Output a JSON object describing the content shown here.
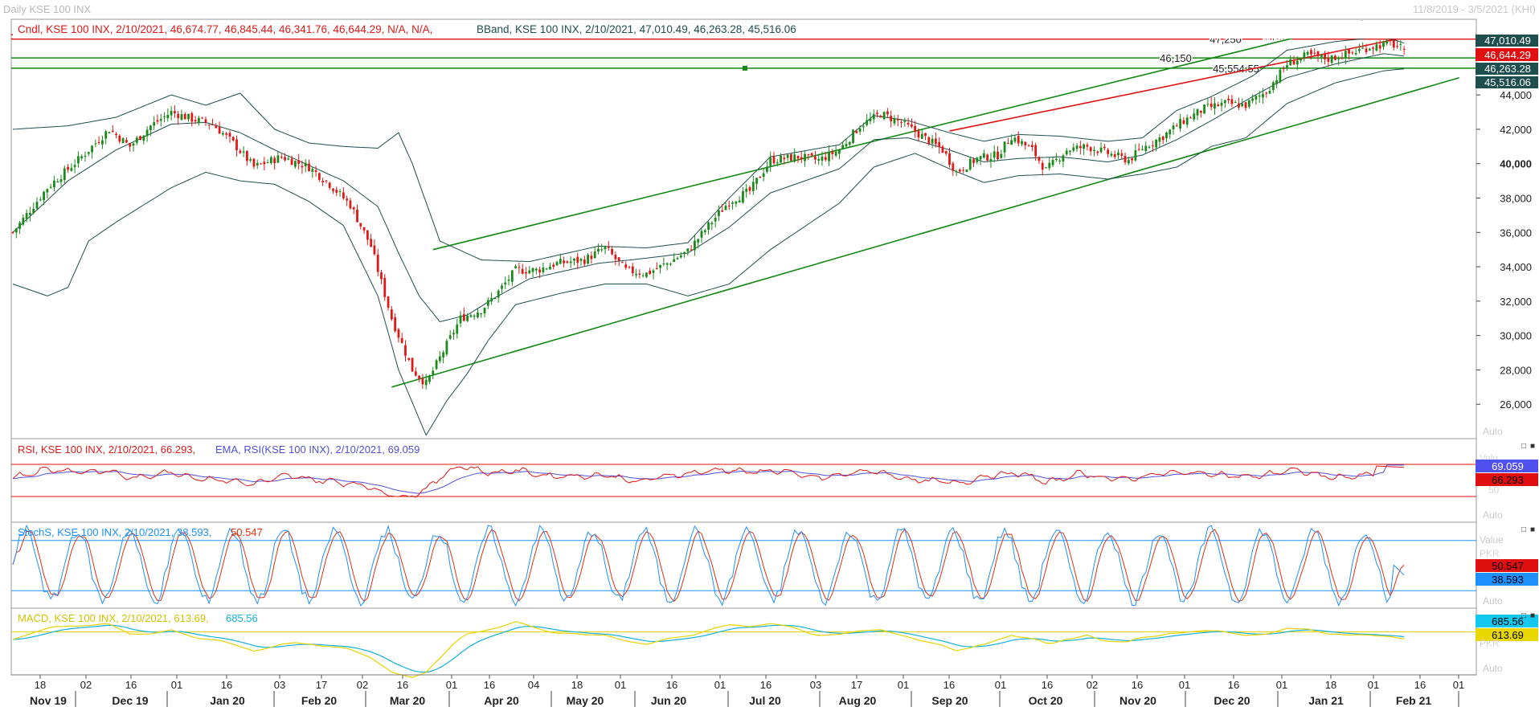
{
  "window": {
    "title": "Daily KSE 100 INX",
    "date_range": "11/8/2019 - 3/5/2021 (KHI)"
  },
  "colors": {
    "up": "#1a8a1a",
    "down": "#e01818",
    "bband": "#1f4e4e",
    "trendline_green": "#118811",
    "trendline_red": "#e01010",
    "rsi": "#e01818",
    "rsi_ema": "#5050dd",
    "stoch_k": "#1e90ff",
    "stoch_d": "#e03010",
    "macd": "#e8d200",
    "macd_signal": "#12b0e0",
    "price_tag_bg": "#1f4e4e"
  },
  "main_panel": {
    "legend_candle": "Cndl, KSE 100 INX, 2/10/2021, 46,674.77, 46,845.44, 46,341.76, 46,644.29, N/A, N/A,",
    "legend_bband": "BBand, KSE 100 INX, 2/10/2021, 47,010.49, 46,263.28, 45,516.06",
    "price_tags": [
      "47,010.49",
      "46,644.29",
      "46,263.28",
      "45,516.06"
    ],
    "hline_labels": [
      "47,500",
      "47,250",
      "46,150",
      "45,554.55"
    ],
    "auto_label": "Auto"
  },
  "rsi_panel": {
    "legend_rsi": "RSI, KSE 100 INX, 2/10/2021, 66.293,",
    "legend_ema": "EMA, RSI(KSE 100 INX), 2/10/2021, 69.059",
    "tags": [
      "69.059",
      "66.293"
    ],
    "ghost_axis": [
      "Valu",
      "50"
    ],
    "auto_label": "Auto"
  },
  "stoch_panel": {
    "legend_k": "StochS, KSE 100 INX, 2/10/2021, 38.593,",
    "legend_d": "50.547",
    "axis_top": "Value",
    "axis_ghost": "PKR",
    "tags": [
      "50.547",
      "38.593"
    ],
    "auto_label": "Auto"
  },
  "macd_panel": {
    "legend_macd": "MACD, KSE 100 INX, 2/10/2021, 613.69,",
    "legend_signal": "685.56",
    "tags": [
      "685.56",
      "613.69"
    ],
    "axis_ghost": "PKR",
    "auto_label": "Auto"
  },
  "x_axis": {
    "day_ticks": [
      "18",
      "02",
      "16",
      "01",
      "16",
      "03",
      "17",
      "02",
      "16",
      "01",
      "16",
      "04",
      "18",
      "01",
      "16",
      "01",
      "16",
      "03",
      "17",
      "01",
      "16",
      "01",
      "16",
      "02",
      "16",
      "01",
      "16",
      "01",
      "18",
      "01",
      "16",
      "01"
    ],
    "month_labels": [
      "Nov 19",
      "Dec 19",
      "Jan 20",
      "Feb 20",
      "Mar 20",
      "Apr 20",
      "May 20",
      "Jun 20",
      "Jul 20",
      "Aug 20",
      "Sep 20",
      "Oct 20",
      "Nov 20",
      "Dec 20",
      "Jan 21",
      "Feb 21"
    ]
  },
  "chart_data": {
    "type": "candlestick",
    "title": "Daily KSE 100 INX",
    "period": "11/8/2019 - 3/5/2021",
    "last_bar": {
      "date": "2/10/2021",
      "open": 46674.77,
      "high": 46845.44,
      "low": 46341.76,
      "close": 46644.29
    },
    "y_ticks": [
      "44,000",
      "42,000",
      "40,000",
      "38,000",
      "36,000",
      "34,000",
      "32,000",
      "30,000",
      "28,000",
      "26,000"
    ],
    "ylim": [
      24000,
      48400
    ],
    "close_path": [
      [
        0,
        36000
      ],
      [
        10,
        38600
      ],
      [
        20,
        40400
      ],
      [
        28,
        42000
      ],
      [
        34,
        41000
      ],
      [
        40,
        42200
      ],
      [
        46,
        43000
      ],
      [
        52,
        42600
      ],
      [
        58,
        42300
      ],
      [
        64,
        41200
      ],
      [
        70,
        39800
      ],
      [
        78,
        40400
      ],
      [
        86,
        39800
      ],
      [
        92,
        38800
      ],
      [
        98,
        37600
      ],
      [
        104,
        35200
      ],
      [
        110,
        31000
      ],
      [
        116,
        28000
      ],
      [
        120,
        27200
      ],
      [
        124,
        28700
      ],
      [
        130,
        31000
      ],
      [
        136,
        31500
      ],
      [
        140,
        32300
      ],
      [
        146,
        33800
      ],
      [
        152,
        33800
      ],
      [
        158,
        34200
      ],
      [
        166,
        34400
      ],
      [
        172,
        35100
      ],
      [
        178,
        33800
      ],
      [
        184,
        33600
      ],
      [
        190,
        34200
      ],
      [
        196,
        34900
      ],
      [
        202,
        36400
      ],
      [
        208,
        37800
      ],
      [
        214,
        38400
      ],
      [
        220,
        40200
      ],
      [
        228,
        40400
      ],
      [
        234,
        40200
      ],
      [
        240,
        40800
      ],
      [
        246,
        42200
      ],
      [
        252,
        42900
      ],
      [
        258,
        42400
      ],
      [
        264,
        41600
      ],
      [
        270,
        40800
      ],
      [
        274,
        39500
      ],
      [
        280,
        40300
      ],
      [
        286,
        40500
      ],
      [
        290,
        41600
      ],
      [
        296,
        40800
      ],
      [
        300,
        39600
      ],
      [
        306,
        40800
      ],
      [
        312,
        41000
      ],
      [
        318,
        40600
      ],
      [
        324,
        40200
      ],
      [
        328,
        40900
      ],
      [
        334,
        41600
      ],
      [
        340,
        42500
      ],
      [
        346,
        43200
      ],
      [
        352,
        43500
      ],
      [
        358,
        43400
      ],
      [
        364,
        44200
      ],
      [
        370,
        45800
      ],
      [
        376,
        46300
      ],
      [
        382,
        46100
      ],
      [
        388,
        46400
      ],
      [
        394,
        46800
      ],
      [
        400,
        47000
      ],
      [
        404,
        46644.29
      ]
    ],
    "bbands": {
      "upper": [
        [
          0,
          42000
        ],
        [
          16,
          42200
        ],
        [
          30,
          42700
        ],
        [
          46,
          44000
        ],
        [
          56,
          43400
        ],
        [
          66,
          44100
        ],
        [
          76,
          42000
        ],
        [
          86,
          41200
        ],
        [
          96,
          41000
        ],
        [
          106,
          40900
        ],
        [
          112,
          41800
        ],
        [
          116,
          40000
        ],
        [
          124,
          35500
        ],
        [
          136,
          34400
        ],
        [
          150,
          34300
        ],
        [
          170,
          35200
        ],
        [
          184,
          35100
        ],
        [
          196,
          35400
        ],
        [
          208,
          38000
        ],
        [
          220,
          40400
        ],
        [
          240,
          41100
        ],
        [
          250,
          42800
        ],
        [
          260,
          42500
        ],
        [
          272,
          41800
        ],
        [
          282,
          41300
        ],
        [
          292,
          41700
        ],
        [
          304,
          41600
        ],
        [
          318,
          41300
        ],
        [
          328,
          41500
        ],
        [
          338,
          43100
        ],
        [
          348,
          43900
        ],
        [
          360,
          45100
        ],
        [
          370,
          46600
        ],
        [
          384,
          47100
        ],
        [
          398,
          47400
        ],
        [
          404,
          47010.49
        ]
      ],
      "middle": [
        [
          0,
          36000
        ],
        [
          16,
          39000
        ],
        [
          30,
          40800
        ],
        [
          46,
          42300
        ],
        [
          56,
          42400
        ],
        [
          66,
          41800
        ],
        [
          76,
          40800
        ],
        [
          86,
          39900
        ],
        [
          96,
          39000
        ],
        [
          106,
          37500
        ],
        [
          112,
          34800
        ],
        [
          118,
          32300
        ],
        [
          124,
          30800
        ],
        [
          132,
          31200
        ],
        [
          140,
          32200
        ],
        [
          150,
          33300
        ],
        [
          170,
          34200
        ],
        [
          184,
          34500
        ],
        [
          196,
          34800
        ],
        [
          208,
          36300
        ],
        [
          220,
          38300
        ],
        [
          240,
          39700
        ],
        [
          250,
          41400
        ],
        [
          260,
          41500
        ],
        [
          272,
          40800
        ],
        [
          282,
          40100
        ],
        [
          292,
          40300
        ],
        [
          304,
          40400
        ],
        [
          318,
          40100
        ],
        [
          328,
          40500
        ],
        [
          338,
          41400
        ],
        [
          348,
          42500
        ],
        [
          360,
          43900
        ],
        [
          370,
          45000
        ],
        [
          384,
          45800
        ],
        [
          398,
          46400
        ],
        [
          404,
          46263.28
        ]
      ],
      "lower": [
        [
          0,
          33000
        ],
        [
          10,
          32300
        ],
        [
          16,
          32800
        ],
        [
          22,
          35500
        ],
        [
          30,
          36600
        ],
        [
          46,
          38600
        ],
        [
          56,
          39500
        ],
        [
          66,
          39000
        ],
        [
          76,
          38800
        ],
        [
          86,
          37800
        ],
        [
          96,
          36400
        ],
        [
          106,
          32300
        ],
        [
          112,
          28000
        ],
        [
          120,
          24200
        ],
        [
          126,
          26200
        ],
        [
          132,
          27800
        ],
        [
          138,
          29700
        ],
        [
          146,
          31800
        ],
        [
          160,
          32500
        ],
        [
          172,
          33000
        ],
        [
          184,
          33000
        ],
        [
          196,
          32300
        ],
        [
          208,
          33000
        ],
        [
          220,
          35000
        ],
        [
          240,
          37700
        ],
        [
          250,
          39800
        ],
        [
          262,
          40600
        ],
        [
          272,
          39700
        ],
        [
          282,
          38900
        ],
        [
          292,
          39300
        ],
        [
          304,
          39400
        ],
        [
          318,
          39100
        ],
        [
          328,
          39400
        ],
        [
          338,
          39800
        ],
        [
          348,
          41000
        ],
        [
          358,
          41500
        ],
        [
          370,
          43500
        ],
        [
          384,
          44700
        ],
        [
          398,
          45400
        ],
        [
          404,
          45516.06
        ]
      ]
    },
    "horizontal_levels": [
      {
        "label": "47,500",
        "value": 47500,
        "color": "red"
      },
      {
        "label": "47,250",
        "value": 47250,
        "color": "red"
      },
      {
        "label": "46,150",
        "value": 46150,
        "color": "green"
      },
      {
        "label": "45,554.55",
        "value": 45554.55,
        "color": "green"
      }
    ],
    "trendlines": [
      {
        "color": "green",
        "from": [
          122,
          35000
        ],
        "to": [
          392,
          48300
        ]
      },
      {
        "color": "green",
        "from": [
          110,
          27000
        ],
        "to": [
          420,
          45000
        ]
      },
      {
        "color": "red",
        "from": [
          272,
          41900
        ],
        "to": [
          408,
          47500
        ]
      }
    ],
    "indicators": {
      "rsi": {
        "last": 66.293,
        "ema_last": 69.059,
        "levels": [
          70,
          30
        ]
      },
      "stoch": {
        "k_last": 38.593,
        "d_last": 50.547,
        "levels": [
          80,
          20
        ]
      },
      "macd": {
        "macd_last": 613.69,
        "signal_last": 685.56
      }
    }
  }
}
